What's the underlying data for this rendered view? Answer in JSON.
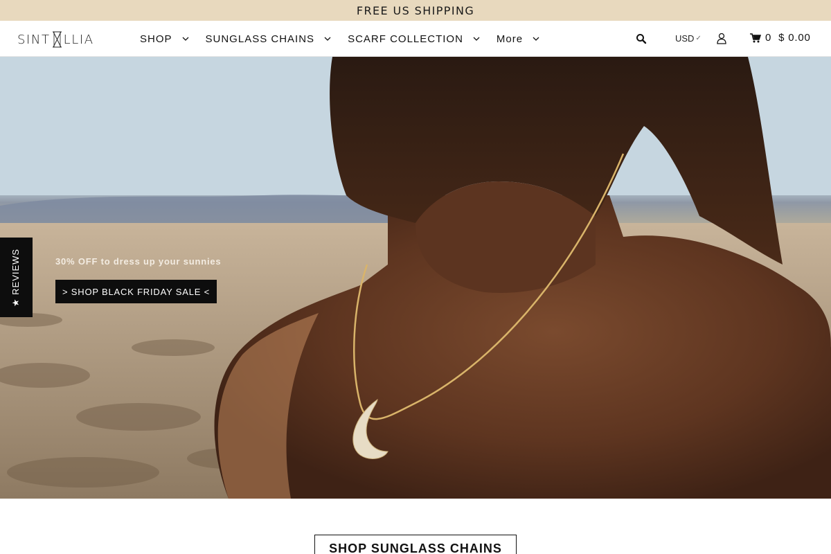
{
  "announcement": {
    "text": "FREE US SHIPPING"
  },
  "brand": {
    "logo_left": "SINT",
    "logo_right": "LLIA"
  },
  "nav": {
    "items": [
      {
        "label": "SHOP"
      },
      {
        "label": "SUNGLASS CHAINS"
      },
      {
        "label": "SCARF COLLECTION"
      },
      {
        "label": "More"
      }
    ]
  },
  "header_tools": {
    "currency": "USD",
    "cart_count": "0",
    "cart_total": "$ 0.00",
    "icons": [
      "search-icon",
      "account-icon",
      "cart-icon",
      "chevron-down-icon"
    ]
  },
  "hero": {
    "promo_text": "30% OFF to dress up your sunnies",
    "button_label": "> SHOP BLACK FRIDAY SALE <"
  },
  "reviews_tab": {
    "label": "★ REVIEWS"
  },
  "section": {
    "button_label": "SHOP SUNGLASS CHAINS"
  },
  "colors": {
    "announcement_bg": "#e8d9be",
    "button_bg": "#0d0d0d",
    "header_bg": "#ffffff"
  }
}
